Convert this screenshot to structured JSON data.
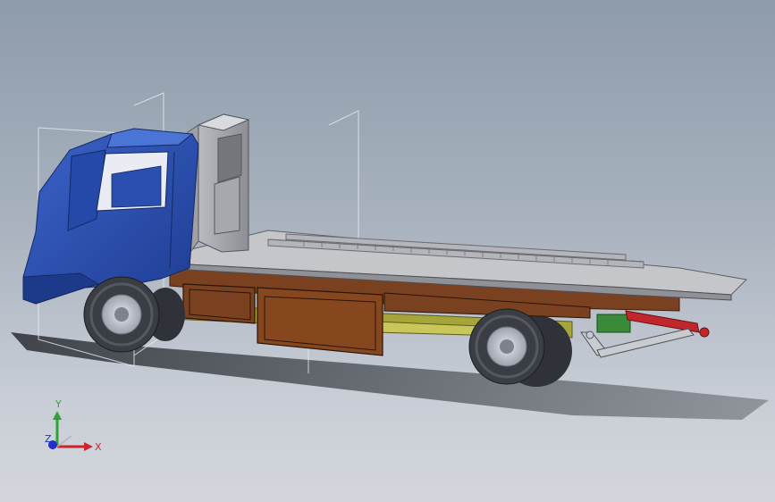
{
  "viewport": {
    "model": "flatbed-tow-truck",
    "background_top": "#8e9bab",
    "background_bottom": "#d3d6dc"
  },
  "colors": {
    "cab": "#2a4fb0",
    "cab_dark": "#1d3a8a",
    "deck": "#a9abb0",
    "deck_top": "#c4c6ca",
    "subframe": "#7a4120",
    "chassis": "#a6a53a",
    "hydraulic": "#c0262a",
    "valve": "#3a8a3a",
    "tire": "#3a3d44",
    "rim": "#c9cdd6"
  },
  "triad": {
    "x_label": "X",
    "y_label": "Y",
    "z_label": "Z",
    "x_color": "#d0242a",
    "y_color": "#2fa336",
    "z_color": "#2030c8"
  }
}
